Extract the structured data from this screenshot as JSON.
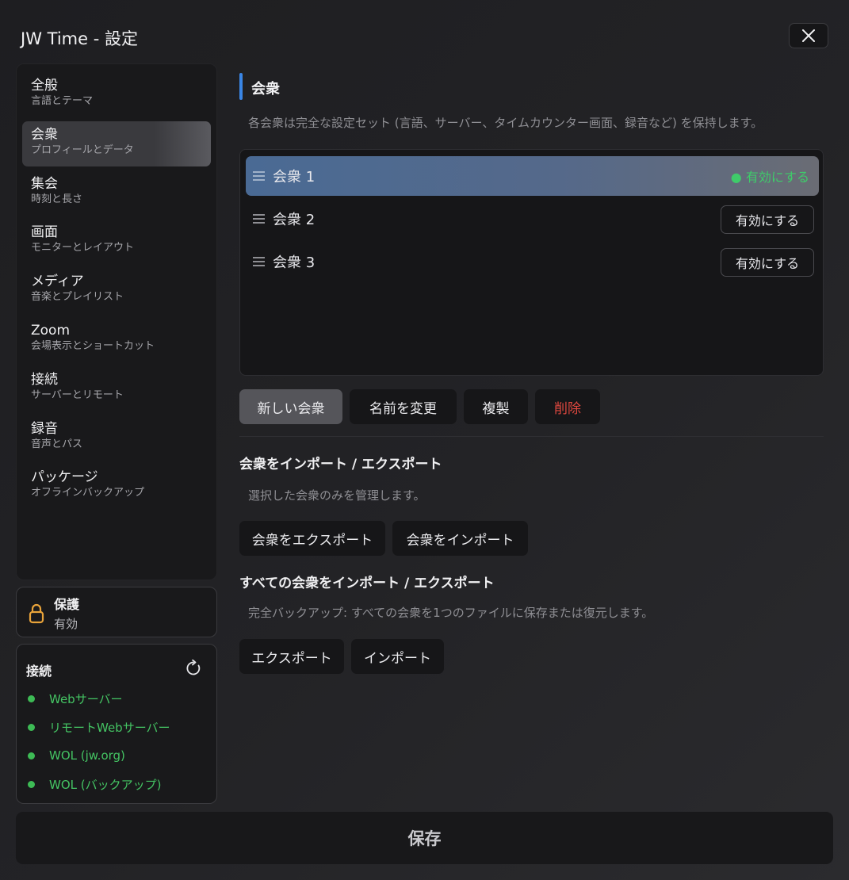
{
  "window": {
    "title": "JW Time - 設定"
  },
  "sidebar": {
    "items": [
      {
        "label": "全般",
        "sub": "言語とテーマ"
      },
      {
        "label": "会衆",
        "sub": "プロフィールとデータ"
      },
      {
        "label": "集会",
        "sub": "時刻と長さ"
      },
      {
        "label": "画面",
        "sub": "モニターとレイアウト"
      },
      {
        "label": "メディア",
        "sub": "音楽とプレイリスト"
      },
      {
        "label": "Zoom",
        "sub": "会場表示とショートカット"
      },
      {
        "label": "接続",
        "sub": "サーバーとリモート"
      },
      {
        "label": "録音",
        "sub": "音声とパス"
      },
      {
        "label": "パッケージ",
        "sub": "オフラインバックアップ"
      }
    ],
    "active_index": 1
  },
  "protection": {
    "title": "保護",
    "status": "有効",
    "icon": "lock-icon",
    "icon_color": "#e8a33a"
  },
  "connections": {
    "title": "接続",
    "items": [
      {
        "label": "Webサーバー",
        "status": "ok"
      },
      {
        "label": "リモートWebサーバー",
        "status": "ok"
      },
      {
        "label": "WOL (jw.org)",
        "status": "ok"
      },
      {
        "label": "WOL (バックアップ)",
        "status": "ok"
      }
    ],
    "status_color": "#3dbb55"
  },
  "main": {
    "section_title": "会衆",
    "description": "各会衆は完全な設定セット (言語、サーバー、タイムカウンター画面、録音など) を保持します。",
    "congregations": [
      {
        "name": "会衆 1",
        "active": true,
        "active_label": "● 有効にする"
      },
      {
        "name": "会衆 2",
        "active": false,
        "button_label": "有効にする"
      },
      {
        "name": "会衆 3",
        "active": false,
        "button_label": "有効にする"
      }
    ],
    "actions": {
      "new": "新しい会衆",
      "rename": "名前を変更",
      "duplicate": "複製",
      "delete": "削除"
    },
    "import_export_single": {
      "title": "会衆をインポート / エクスポート",
      "description": "選択した会衆のみを管理します。",
      "export": "会衆をエクスポート",
      "import": "会衆をインポート"
    },
    "import_export_all": {
      "title": "すべての会衆をインポート / エクスポート",
      "description": "完全バックアップ: すべての会衆を1つのファイルに保存または復元します。",
      "export": "エクスポート",
      "import": "インポート"
    },
    "accent_color": "#3a86e6",
    "danger_color": "#e0483f"
  },
  "footer": {
    "save_label": "保存"
  }
}
